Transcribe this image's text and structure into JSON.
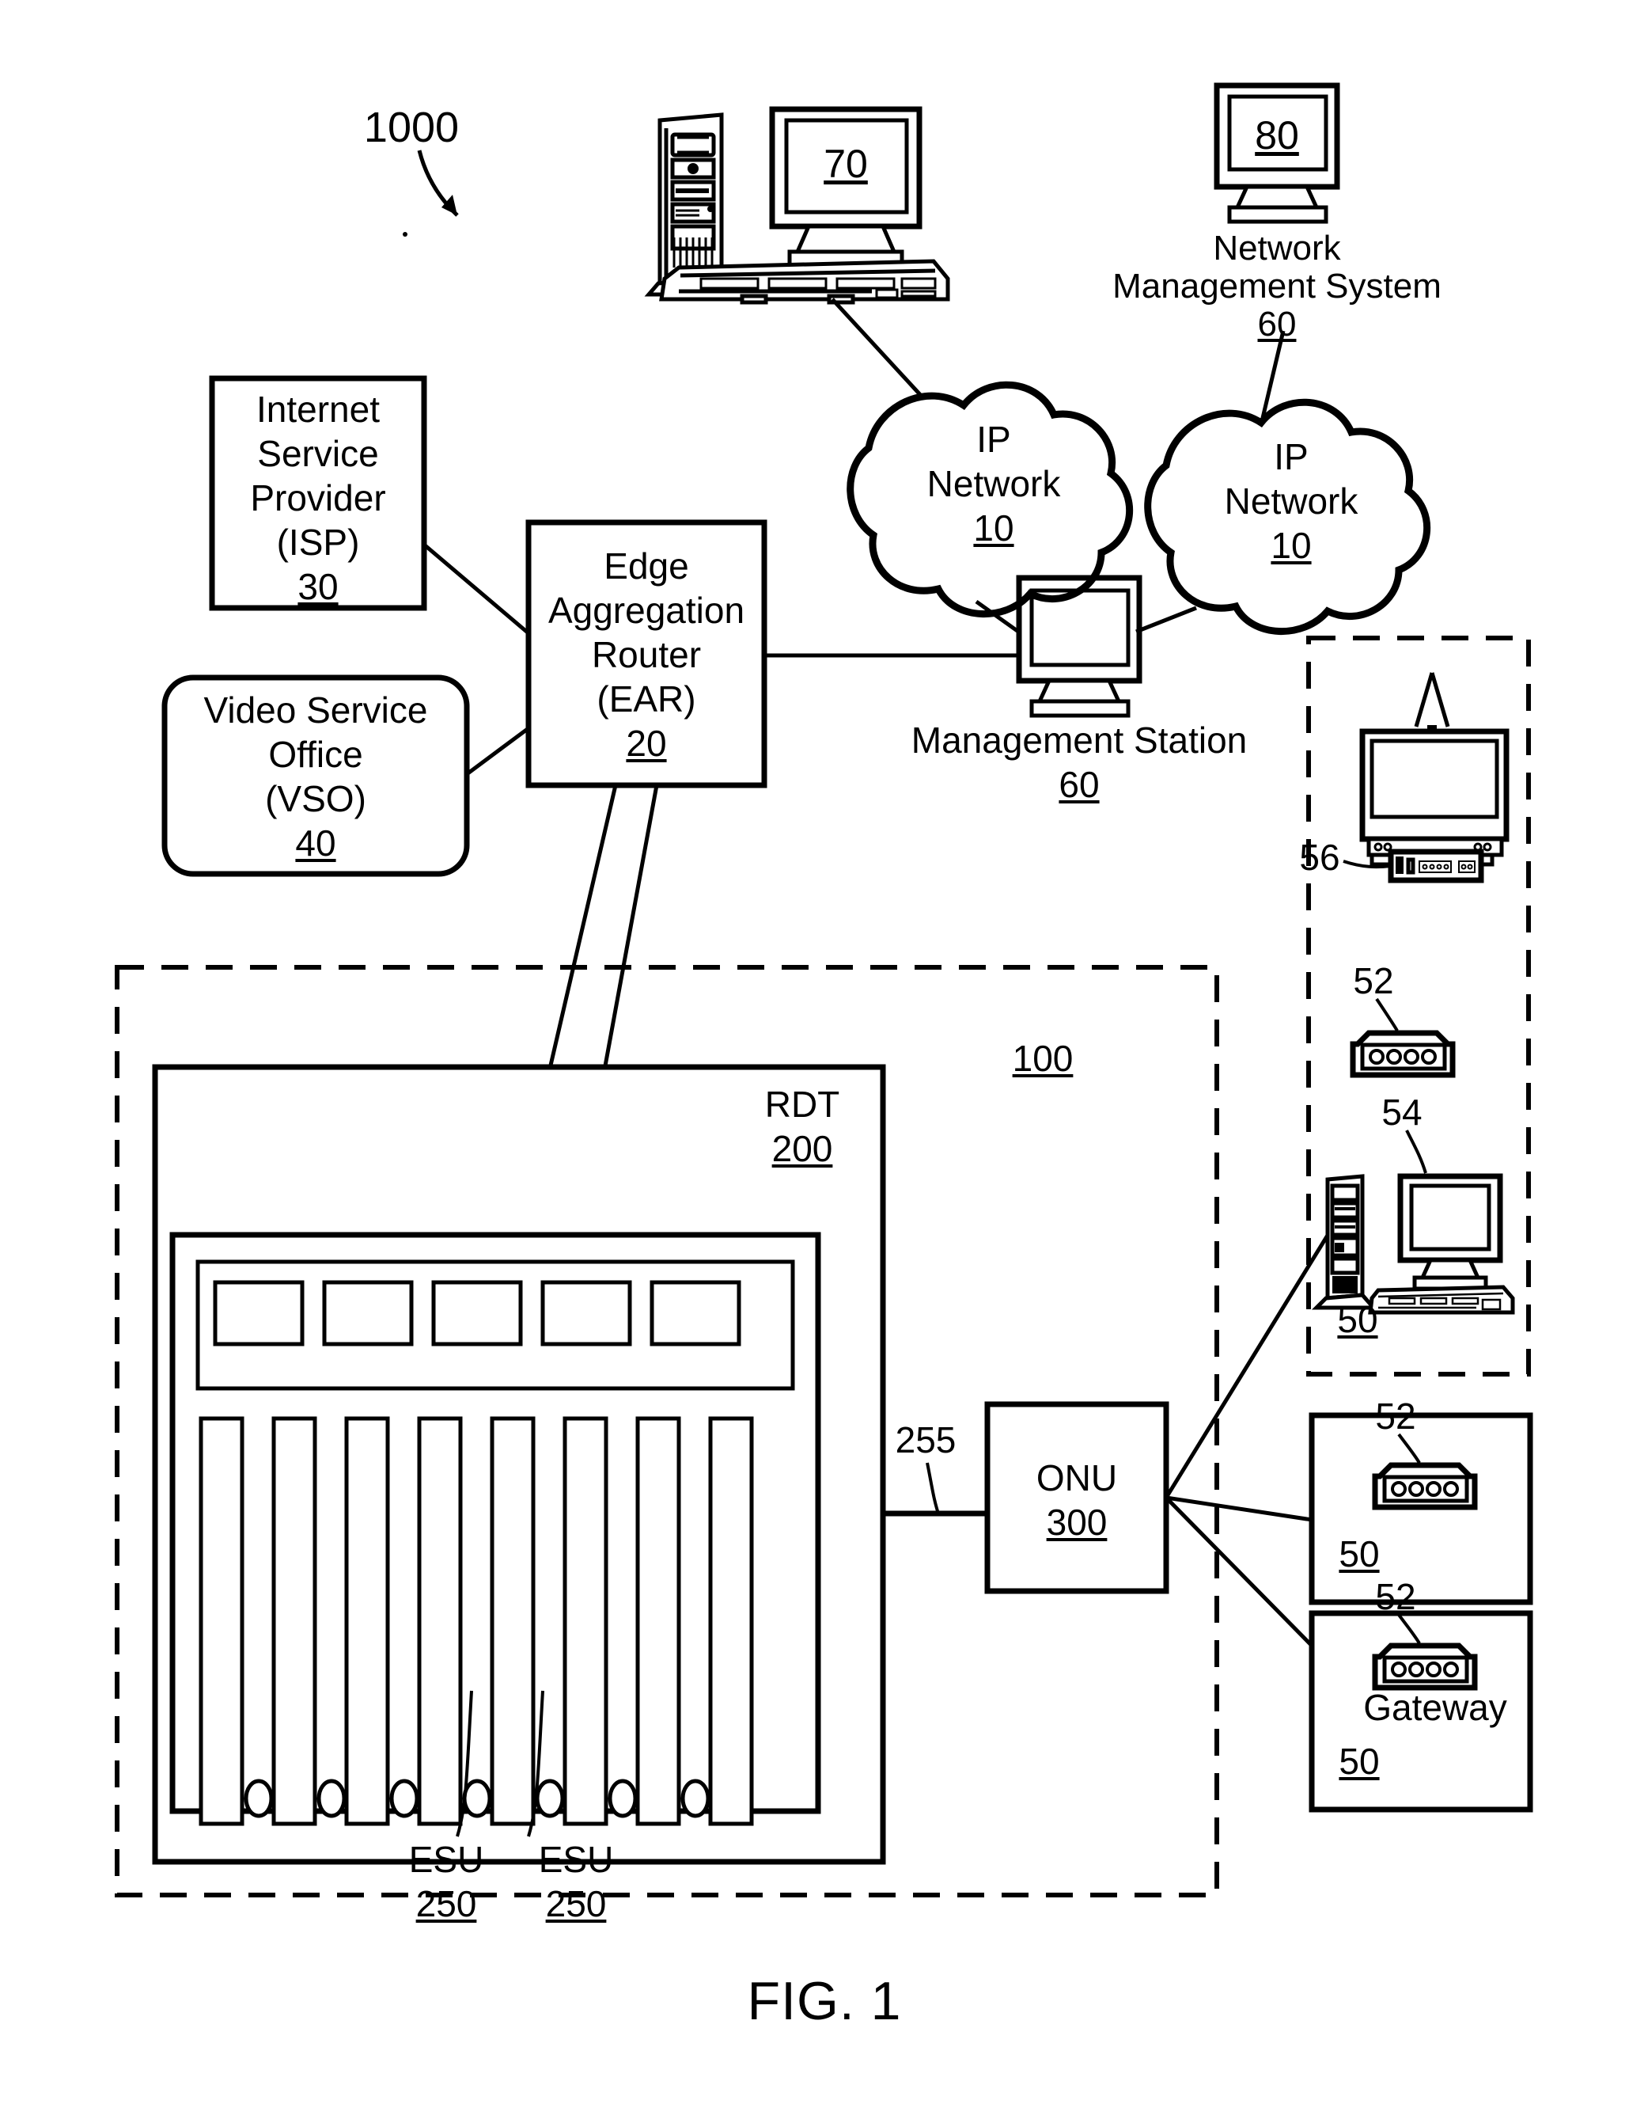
{
  "figure": {
    "caption": "FIG. 1",
    "system_ref": "1000"
  },
  "nodes": {
    "workstation_70": {
      "screen_label": "70",
      "name": "workstation-70"
    },
    "nms": {
      "screen_label": "80",
      "line1": "Network",
      "line2": "Management System",
      "ref": "60"
    },
    "ip_network_left": {
      "line1": "IP",
      "line2": "Network",
      "ref": "10"
    },
    "ip_network_right": {
      "line1": "IP",
      "line2": "Network",
      "ref": "10"
    },
    "isp": {
      "line1": "Internet",
      "line2": "Service",
      "line3": "Provider",
      "line4": "(ISP)",
      "ref": "30"
    },
    "vso": {
      "line1": "Video Service",
      "line2": "Office",
      "line3": "(VSO)",
      "ref": "40"
    },
    "ear": {
      "line1": "Edge",
      "line2": "Aggregation",
      "line3": "Router",
      "line4": "(EAR)",
      "ref": "20"
    },
    "management_station": {
      "label": "Management Station",
      "ref": "60"
    },
    "rdt": {
      "label": "RDT",
      "ref": "200"
    },
    "onu": {
      "label": "ONU",
      "ref": "300"
    },
    "link_255": {
      "ref": "255"
    },
    "esu_left": {
      "label": "ESU",
      "ref": "250"
    },
    "esu_right": {
      "label": "ESU",
      "ref": "250"
    },
    "access_network": {
      "ref": "100"
    }
  },
  "premises": {
    "tv_premises": {
      "set_top_box_ref": "56"
    },
    "computer_premises": {
      "gateway_ref": "52",
      "computer_ref": "54",
      "premises_ref": "50"
    },
    "router_premises_1": {
      "gateway_ref": "52",
      "premises_ref": "50"
    },
    "gateway_premises": {
      "gateway_ref": "52",
      "gateway_label": "Gateway",
      "premises_ref": "50"
    }
  },
  "colors": {
    "ink": "#000000",
    "paper": "#ffffff"
  }
}
